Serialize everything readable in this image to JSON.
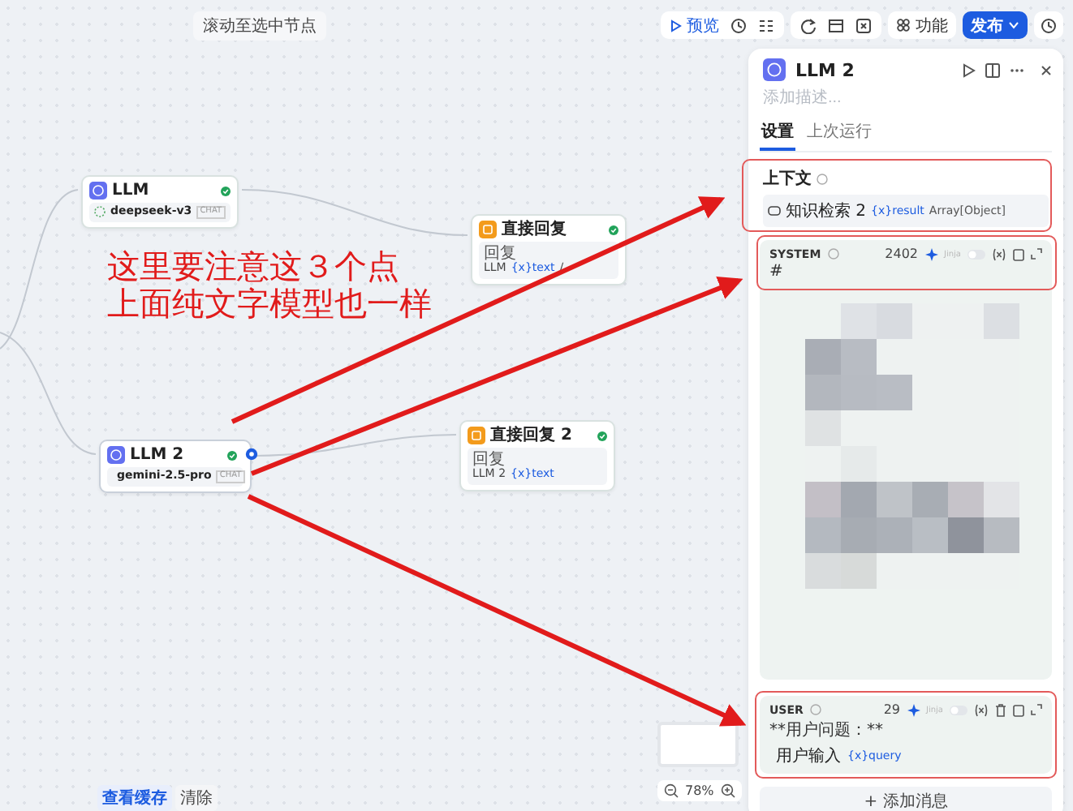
{
  "canvas_hint": "滚动至选中节点",
  "toolbar": {
    "preview": "预览",
    "features": "功能",
    "publish": "发布"
  },
  "nodes": [
    {
      "kind": "llm",
      "title": "LLM",
      "model": "deepseek-v3",
      "mode": "CHAT",
      "selected": false
    },
    {
      "kind": "answer",
      "title": "直接回复",
      "label": "回复",
      "ref_node": "LLM",
      "ref_var": "{x}text",
      "suffix": "/",
      "selected": false
    },
    {
      "kind": "llm",
      "title": "LLM 2",
      "model": "gemini-2.5-pro",
      "mode": "CHAT",
      "selected": true
    },
    {
      "kind": "answer",
      "title": "直接回复 2",
      "label": "回复",
      "ref_node": "LLM 2",
      "ref_var": "{x}text",
      "selected": false
    }
  ],
  "annotation": [
    "这里要注意这３个点",
    "上面纯文字模型也一样"
  ],
  "panel": {
    "title": "LLM 2",
    "description_placeholder": "添加描述...",
    "tabs": [
      {
        "label": "设置",
        "selected": true
      },
      {
        "label": "上次运行",
        "selected": false
      }
    ],
    "context": {
      "label": "上下文",
      "source": "知识检索 2",
      "var": "{x}result",
      "type": "Array[Object]"
    },
    "messages": [
      {
        "kind": "redacted",
        "role": "SYSTEM",
        "count": "2402",
        "jinja": "Jinja",
        "jinja_on": false,
        "text": "#"
      },
      {
        "kind": "plain",
        "role": "USER",
        "count": "29",
        "jinja": "Jinja",
        "jinja_on": false,
        "text": "**用户问题：**",
        "ref_node": "用户输入",
        "ref_var": "{x}query"
      }
    ],
    "add_message": "+ 添加消息"
  },
  "bottom": {
    "view_cache": "查看缓存",
    "clear": "清除",
    "zoom": "78%"
  }
}
